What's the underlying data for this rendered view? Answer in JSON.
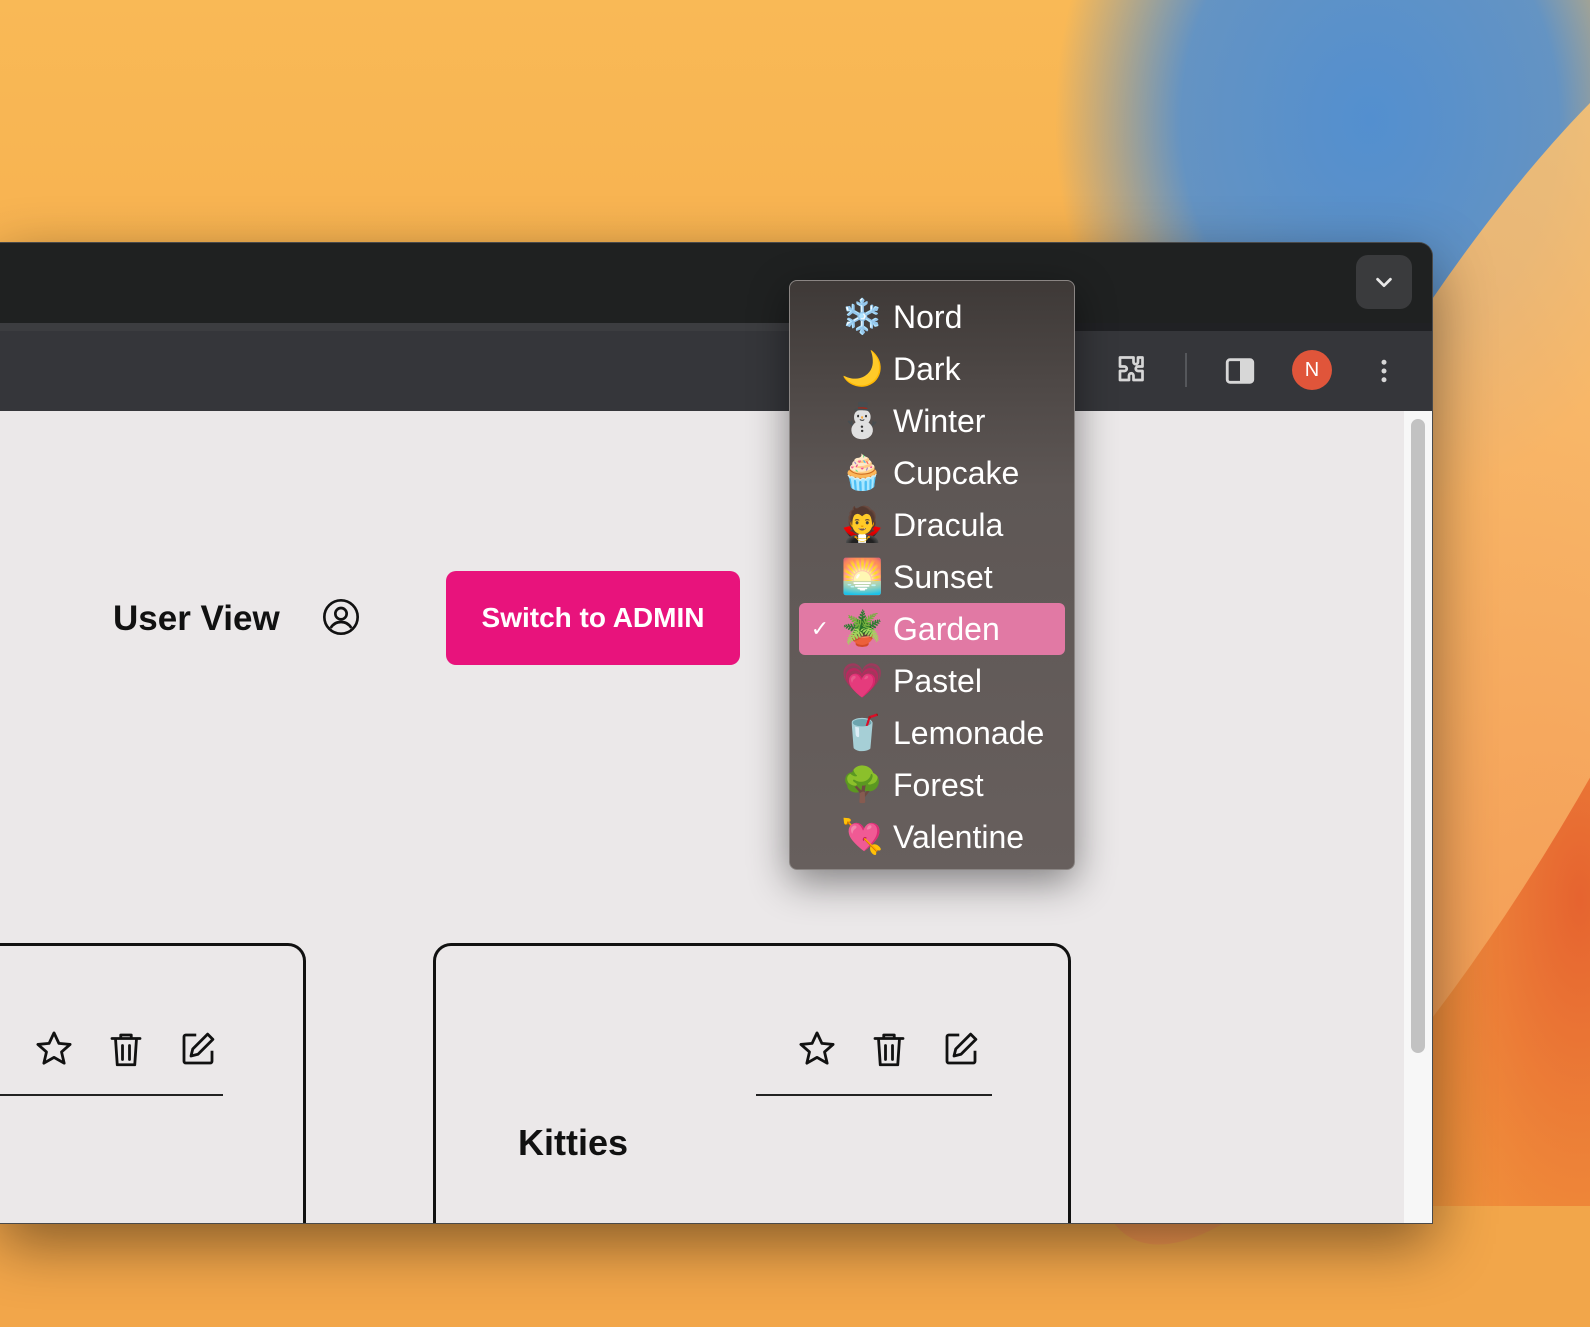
{
  "browser": {
    "profile_initial": "N",
    "tab_search_icon": "chevron-down-icon",
    "toolbar_icons": [
      "extensions-icon",
      "side-panel-icon",
      "more-vert-icon"
    ]
  },
  "header": {
    "view_label": "User View",
    "view_icon": "user-circle-icon",
    "switch_button_label": "Switch to ADMIN",
    "accent_color": "#e8137c"
  },
  "theme_menu": {
    "selected": "Garden",
    "selected_color": "#e179a4",
    "options": [
      {
        "emoji": "❄️",
        "label": "Nord"
      },
      {
        "emoji": "🌙",
        "label": "Dark"
      },
      {
        "emoji": "⛄",
        "label": "Winter"
      },
      {
        "emoji": "🧁",
        "label": "Cupcake"
      },
      {
        "emoji": "🧛",
        "label": "Dracula"
      },
      {
        "emoji": "🌅",
        "label": "Sunset"
      },
      {
        "emoji": "🪴",
        "label": "Garden"
      },
      {
        "emoji": "💗",
        "label": "Pastel"
      },
      {
        "emoji": "🥤",
        "label": "Lemonade"
      },
      {
        "emoji": "🌳",
        "label": "Forest"
      },
      {
        "emoji": "💘",
        "label": "Valentine"
      }
    ],
    "check_mark": "✓"
  },
  "cards": [
    {
      "title": "",
      "actions": [
        "star-icon",
        "trash-icon",
        "edit-icon"
      ]
    },
    {
      "title": "Kitties",
      "actions": [
        "star-icon",
        "trash-icon",
        "edit-icon"
      ]
    }
  ]
}
